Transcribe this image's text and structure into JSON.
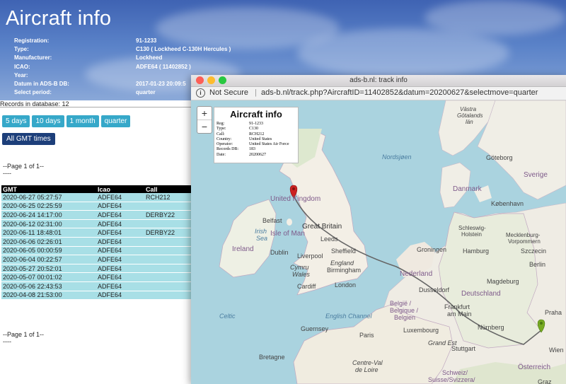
{
  "page": {
    "title": "Aircraft info",
    "details": [
      {
        "label": "Registration:",
        "value": "91-1233"
      },
      {
        "label": "Type:",
        "value": "C130 ( Lockheed C-130H Hercules )"
      },
      {
        "label": "Manufacturer:",
        "value": "Lockheed"
      },
      {
        "label": "ICAO:",
        "value": "ADFE64 ( 11402852 )"
      },
      {
        "label": "Year:",
        "value": ""
      },
      {
        "label": "Datum in ADS-B DB:",
        "value": "2017-01-23 20:09:5"
      },
      {
        "label": "Select period:",
        "value": "quarter"
      }
    ],
    "records_text": "Records in database: 12",
    "period_buttons": [
      "5 days",
      "10 days",
      "1 month",
      "quarter"
    ],
    "gmt_button": "All GMT times",
    "pager_top": "--Page 1 of 1--",
    "pager_top_dashes": "----",
    "pager_bottom": "--Page 1 of 1--",
    "pager_bottom_dashes": "----",
    "table": {
      "headers": [
        "GMT",
        "Icao",
        "Call"
      ],
      "rows": [
        [
          "2020-06-27 05:27:57",
          "ADFE64",
          "RCH212"
        ],
        [
          "2020-06-25 02:25:59",
          "ADFE64",
          ""
        ],
        [
          "2020-06-24 14:17:00",
          "ADFE64",
          "DERBY22"
        ],
        [
          "2020-06-12 02:31:00",
          "ADFE64",
          ""
        ],
        [
          "2020-06-11 18:48:01",
          "ADFE64",
          "DERBY22"
        ],
        [
          "2020-06-06 02:26:01",
          "ADFE64",
          ""
        ],
        [
          "2020-06-05 00:00:59",
          "ADFE64",
          ""
        ],
        [
          "2020-06-04 00:22:57",
          "ADFE64",
          ""
        ],
        [
          "2020-05-27 20:52:01",
          "ADFE64",
          ""
        ],
        [
          "2020-05-07 00:01:02",
          "ADFE64",
          ""
        ],
        [
          "2020-05-06 22:43:53",
          "ADFE64",
          ""
        ],
        [
          "2020-04-08 21:53:00",
          "ADFE64",
          ""
        ]
      ]
    }
  },
  "popup": {
    "window_title": "ads-b.nl: track info",
    "security": "Not Secure",
    "url": "ads-b.nl/track.php?AircraftID=11402852&datum=20200627&selectmove=quarter",
    "zoom_in": "+",
    "zoom_out": "−",
    "info_box": {
      "title": "Aircraft info",
      "rows": [
        {
          "k": "Reg:",
          "v": "91-1233"
        },
        {
          "k": "Type:",
          "v": "C130"
        },
        {
          "k": "Call:",
          "v": "RCH212"
        },
        {
          "k": "Country:",
          "v": "United States"
        },
        {
          "k": "Operator:",
          "v": "United States Air Force"
        },
        {
          "k": "Records DB:",
          "v": "183"
        },
        {
          "k": "Date:",
          "v": "20200627"
        }
      ]
    },
    "map_labels": {
      "united_kingdom": "United Kingdom",
      "great_britain": "Great Britain",
      "isle_of_man": "Isle of Man",
      "ireland": "Ireland",
      "belfast": "Belfast",
      "dublin": "Dublin",
      "leeds": "Leeds",
      "liverpool": "Liverpool",
      "sheffield": "Sheffield",
      "cymru": "Cymru",
      "wales": "Wales",
      "england": "England",
      "birmingham": "Birmingham",
      "cardiff": "Cardiff",
      "london": "London",
      "guernsey": "Guernsey",
      "bretagne": "Bretagne",
      "nederland": "Nederland",
      "groningen": "Groningen",
      "hamburg": "Hamburg",
      "szczecin": "Szczecin",
      "berlin": "Berlin",
      "magdeburg": "Magdeburg",
      "dusseldorf": "Dusseldorf",
      "deutschland": "Deutschland",
      "belgie": "België /",
      "belgique": "Belgique /",
      "belgien": "Belgien",
      "frankfurt": "Frankfurt",
      "am_main": "am Main",
      "luxembourg": "Luxembourg",
      "nurnberg": "Nürnberg",
      "paris": "Paris",
      "stuttgart": "Stuttgart",
      "grand_est": "Grand Est",
      "centre_val": "Centre-Val",
      "de_loire": "de Loire",
      "schweiz": "Schweiz/",
      "suisse": "Suisse/Svizzera/",
      "osterreich": "Österreich",
      "wien": "Wien",
      "graz": "Graz",
      "danmark": "Danmark",
      "kobenhavn": "København",
      "goteborg": "Göteborg",
      "sverige": "Sverige",
      "nordsjoen": "Nordsjøen",
      "schleswig": "Schleswig-",
      "holstein": "Holstein",
      "mecklenburg": "Mecklenburg-",
      "vorpommern": "Vorpommern",
      "praha": "Praha",
      "vastra": "Västra",
      "gotalands": "Götalands",
      "lan": "län",
      "ireland_sea": "Irish",
      "sea": "Sea",
      "celtic": "Celtic",
      "english_channel": "English Channel"
    },
    "colors": {
      "track": "#666666",
      "start_marker": "#cc2222",
      "end_marker": "#77aa22"
    }
  }
}
